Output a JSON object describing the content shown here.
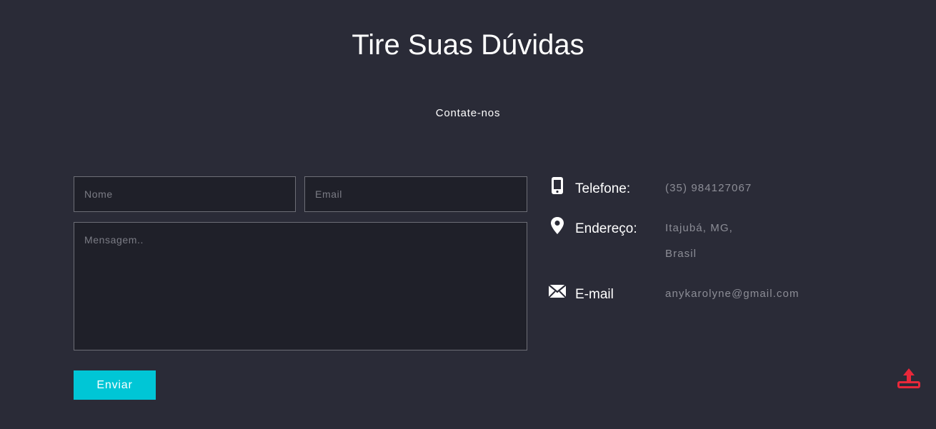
{
  "header": {
    "title": "Tire Suas Dúvidas",
    "subtitle": "Contate-nos"
  },
  "form": {
    "name_placeholder": "Nome",
    "email_placeholder": "Email",
    "message_placeholder": "Mensagem..",
    "send_label": "Enviar"
  },
  "contact": {
    "phone": {
      "icon": "mobile-phone-icon",
      "label": "Telefone:",
      "value": "(35) 984127067"
    },
    "address": {
      "icon": "map-pin-icon",
      "label": "Endereço:",
      "value_line1": "Itajubá, MG,",
      "value_line2": "Brasil"
    },
    "email": {
      "icon": "envelope-icon",
      "label": "E-mail",
      "value": "anykarolyne@gmail.com"
    }
  },
  "scroll_top": {
    "icon": "upload-arrow-icon"
  },
  "colors": {
    "background": "#2a2b37",
    "field_background": "#1f2029",
    "accent": "#00c6d6",
    "scroll_top": "#e8283a"
  }
}
